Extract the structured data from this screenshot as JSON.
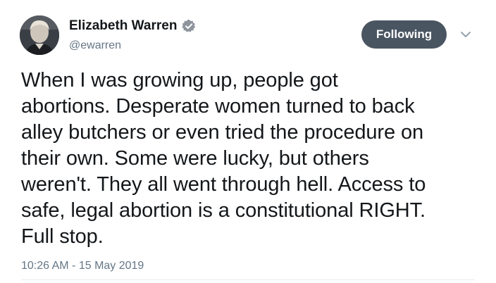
{
  "author": {
    "display_name": "Elizabeth Warren",
    "handle": "@ewarren",
    "verified_icon": "verified-badge-icon",
    "avatar_icon": "profile-photo"
  },
  "follow_button": {
    "label": "Following",
    "color": "#4a5562"
  },
  "menu": {
    "icon": "chevron-down-icon"
  },
  "tweet": {
    "text": "When I was growing up, people got\nabortions. Desperate women turned to back\nalley butchers or even tried the procedure on\ntheir own. Some were lucky, but others\nweren't. They all went through hell. Access to\nsafe, legal abortion is a constitutional RIGHT.\nFull stop.",
    "timestamp": "10:26 AM - 15 May 2019"
  },
  "colors": {
    "text": "#14171a",
    "secondary": "#657786",
    "divider": "#e6ecf0"
  }
}
